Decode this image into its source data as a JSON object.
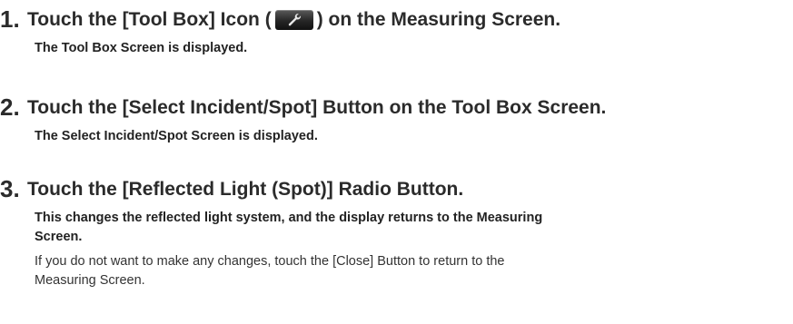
{
  "steps": [
    {
      "number": "1.",
      "title_before": "Touch the [Tool Box] Icon (",
      "title_icon": "wrench-icon",
      "title_after": ") on the Measuring Screen.",
      "result": "The Tool Box Screen is displayed."
    },
    {
      "number": "2.",
      "title": "Touch the [Select Incident/Spot] Button on the Tool Box Screen.",
      "result": "The Select Incident/Spot Screen is displayed."
    },
    {
      "number": "3.",
      "title": "Touch the [Reflected Light (Spot)] Radio Button.",
      "result_line1": "This changes the reflected light system, and the display returns to the Measuring",
      "result_line2": "Screen.",
      "note_line1": "If you do not want to make any changes, touch the [Close] Button to return to the",
      "note_line2": "Measuring Screen."
    }
  ],
  "colors": {
    "text": "#2b2b2b",
    "icon_bg": "#262626",
    "icon_fg": "#e8e8e8"
  }
}
